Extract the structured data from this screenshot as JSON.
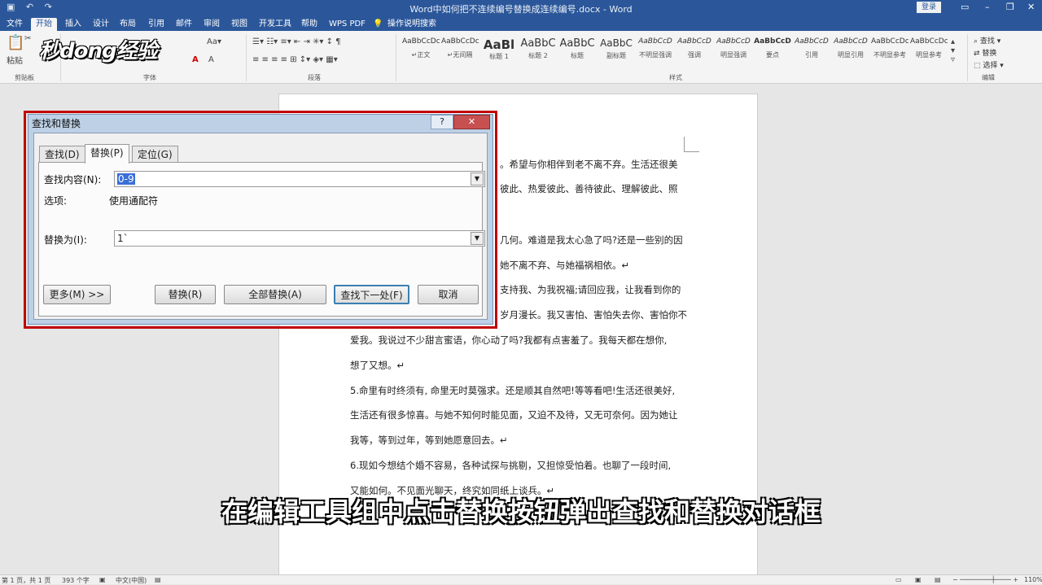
{
  "titlebar": {
    "title": "Word中如何把不连续编号替换成连续编号.docx - Word",
    "login": "登录",
    "undo_icon": "undo-icon",
    "redo_icon": "redo-icon"
  },
  "tabs": [
    "文件",
    "开始",
    "插入",
    "设计",
    "布局",
    "引用",
    "邮件",
    "审阅",
    "视图",
    "开发工具",
    "帮助",
    "WPS PDF",
    "操作说明搜索"
  ],
  "ribbon": {
    "logo_text": "秒dong经验",
    "paste": "粘贴",
    "groups": {
      "clipboard": "剪贴板",
      "font": "字体",
      "paragraph": "段落",
      "styles": "样式",
      "editing": "编辑"
    },
    "styles": [
      {
        "sample": "AaBbCcDc",
        "name": "↵正文"
      },
      {
        "sample": "AaBbCcDc",
        "name": "↵无间隔"
      },
      {
        "sample": "AaBl",
        "name": "标题 1"
      },
      {
        "sample": "AaBbC",
        "name": "标题 2"
      },
      {
        "sample": "AaBbC",
        "name": "标题"
      },
      {
        "sample": "AaBbC",
        "name": "副标题"
      },
      {
        "sample": "AaBbCcD",
        "name": "不明显强调"
      },
      {
        "sample": "AaBbCcD",
        "name": "强调"
      },
      {
        "sample": "AaBbCcD",
        "name": "明显强调"
      },
      {
        "sample": "AaBbCcD",
        "name": "要点"
      },
      {
        "sample": "AaBbCcD",
        "name": "引用"
      },
      {
        "sample": "AaBbCcD",
        "name": "明显引用"
      },
      {
        "sample": "AaBbCcDc",
        "name": "不明显参考"
      },
      {
        "sample": "AaBbCcDc",
        "name": "明显参考"
      }
    ],
    "editing": {
      "find": "查找",
      "replace": "替换",
      "select": "选择"
    }
  },
  "document": {
    "lines_right": [
      "。希望与你相伴到老不离不弃。生活还很美",
      "彼此、热爱彼此、善待彼此、理解彼此、照",
      "几何。难道是我太心急了吗?还是一些别的因",
      "她不离不弃、与她福祸相依。↵",
      "支持我、为我祝福;请回应我，让我看到你的",
      "岁月漫长。我又害怕、害怕失去你、害怕你不"
    ],
    "lines": [
      "爱我。我说过不少甜言蜜语，你心动了吗?我都有点害羞了。我每天都在想你,",
      "想了又想。↵",
      "5.命里有时终须有, 命里无时莫强求。还是顺其自然吧!等等看吧!生活还很美好,",
      "生活还有很多惊喜。与她不知何时能见面，又迫不及待，又无可奈何。因为她让",
      "我等，等到过年，等到她愿意回去。↵",
      "6.现如今想结个婚不容易，各种试探与挑剔，又担惊受怕着。也聊了一段时间,",
      "又能如何。不见面光聊天，终究如同纸上谈兵。↵"
    ]
  },
  "subtitle": "在编辑工具组中点击替换按钮弹出查找和替换对话框",
  "dialog": {
    "title": "查找和替换",
    "help": "?",
    "close": "✕",
    "tabs": [
      "查找(D)",
      "替换(P)",
      "定位(G)"
    ],
    "find_label": "查找内容(N):",
    "find_value": "0-9",
    "options_label": "选项:",
    "options_value": "使用通配符",
    "replace_label": "替换为(I):",
    "replace_value": "1`",
    "buttons": {
      "more": "更多(M) >>",
      "replace": "替换(R)",
      "replace_all": "全部替换(A)",
      "find_next": "查找下一处(F)",
      "cancel": "取消"
    }
  },
  "statusbar": {
    "page": "第 1 页，共 1 页",
    "words": "393 个字",
    "lang": "中文(中国)",
    "zoom": "110%"
  }
}
